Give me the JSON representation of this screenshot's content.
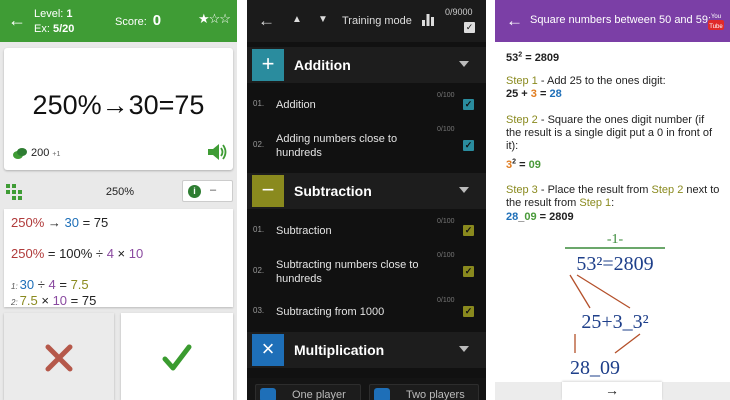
{
  "panel1": {
    "header": {
      "level_label": "Level:",
      "level_value": "1",
      "ex_label": "Ex:",
      "ex_value": "5/20",
      "score_label": "Score:",
      "score_value": "0",
      "stars": {
        "filled": 1,
        "total": 3
      }
    },
    "question": "250%→30=75",
    "points": "200",
    "points_delta": "+1",
    "hint_title": "250%",
    "hint_button_dash": "–",
    "hint_lines": {
      "l1_a": "250%",
      "l1_b": " → ",
      "l1_c": "30",
      "l1_d": " = 75",
      "l2_a": "250%",
      "l2_b": " = 100% ÷ ",
      "l2_c": "4",
      "l2_d": " × ",
      "l2_e": "10",
      "l3_idx": "1:",
      "l3_a": "30",
      "l3_b": " ÷ ",
      "l3_c": "4",
      "l3_d": " = ",
      "l3_e": "7.5",
      "l4_idx": "2:",
      "l4_a": "7.5",
      "l4_b": " × ",
      "l4_c": "10",
      "l4_d": " = 75"
    },
    "colors": {
      "header": "#3f9c35",
      "wrong": "#b5584a",
      "right": "#3a9b2f"
    }
  },
  "panel2": {
    "header": {
      "title": "Training mode",
      "count": "0/9000"
    },
    "categories": [
      {
        "label": "Addition",
        "icon": "+",
        "color": "#2a8c9e",
        "items": [
          {
            "index": "01.",
            "label": "Addition",
            "count": "0/100"
          },
          {
            "index": "02.",
            "label": "Adding numbers close to hundreds",
            "count": "0/100"
          }
        ]
      },
      {
        "label": "Subtraction",
        "icon": "−",
        "color": "#8a8a1e",
        "items": [
          {
            "index": "01.",
            "label": "Subtraction",
            "count": "0/100"
          },
          {
            "index": "02.",
            "label": "Subtracting numbers close to hundreds",
            "count": "0/100"
          },
          {
            "index": "03.",
            "label": "Subtracting from 1000",
            "count": "0/100"
          }
        ]
      },
      {
        "label": "Multiplication",
        "icon": "×",
        "color": "#1e6fb8",
        "items": []
      }
    ],
    "bottom_buttons": [
      {
        "label": "One player"
      },
      {
        "label": "Two players"
      }
    ]
  },
  "panel3": {
    "header": {
      "title": "Square numbers between 50 and 59:"
    },
    "lines": {
      "eq_base": "53",
      "eq_exp": "2",
      "eq_res": " = 2809",
      "s1_label": "Step 1",
      "s1_text": " - Add 25 to the ones digit:",
      "s1_a": "25",
      "s1_b": " + ",
      "s1_c": "3",
      "s1_d": " = ",
      "s1_e": "28",
      "s2_label": "Step 2",
      "s2_text": " - Square the ones digit number (if the result is a single digit put a 0 in front of it):",
      "s2_base": "3",
      "s2_exp": "2",
      "s2_eq": " = ",
      "s2_res": "09",
      "s3_label": "Step 3",
      "s3_text1": " - Place the result from ",
      "s3_ref1": "Step 2",
      "s3_text2": " next to the result from ",
      "s3_ref2": "Step 1",
      "s3_text3": ":",
      "s3_a": "28",
      "s3_b": "_",
      "s3_c": "09",
      "s3_d": " = 2809"
    },
    "handwritten": {
      "top": "-1-",
      "eq": "53²=2809",
      "mid": "25+3_3²",
      "bottom": "28_09"
    },
    "footer_arrow": "→",
    "colors": {
      "header": "#7b3fa6",
      "accent_step": "#8a8a1e",
      "orange": "#e07b1e",
      "green": "#4a9a3a"
    }
  }
}
